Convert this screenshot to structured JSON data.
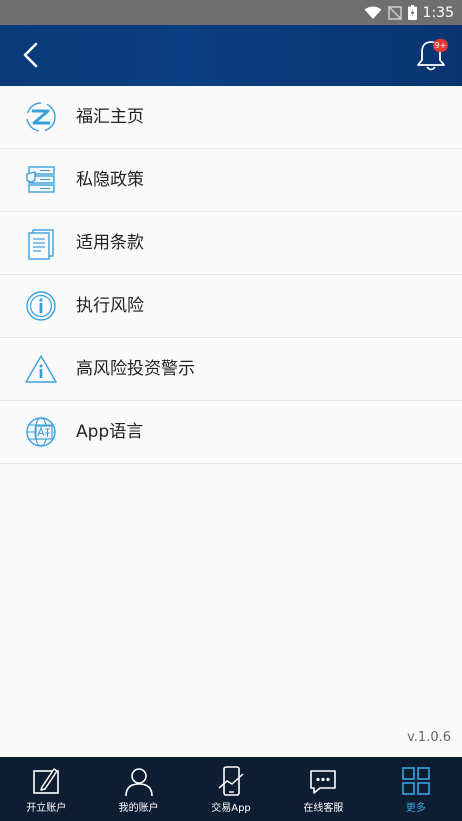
{
  "status_bar": {
    "time": "1:35"
  },
  "header": {
    "notification_badge": "9+"
  },
  "menu": [
    {
      "label": "福汇主页",
      "icon": "fxcm-logo-icon"
    },
    {
      "label": "私隐政策",
      "icon": "privacy-server-icon"
    },
    {
      "label": "适用条款",
      "icon": "document-icon"
    },
    {
      "label": "执行风险",
      "icon": "info-circle-icon"
    },
    {
      "label": "高风险投资警示",
      "icon": "warning-triangle-icon"
    },
    {
      "label": "App语言",
      "icon": "globe-language-icon"
    }
  ],
  "version": "v.1.0.6",
  "tabs": [
    {
      "label": "开立账户",
      "icon": "edit-form-icon",
      "active": false
    },
    {
      "label": "我的账户",
      "icon": "user-icon",
      "active": false
    },
    {
      "label": "交易App",
      "icon": "phone-chart-icon",
      "active": false
    },
    {
      "label": "在线客服",
      "icon": "chat-icon",
      "active": false
    },
    {
      "label": "更多",
      "icon": "grid-icon",
      "active": true
    }
  ],
  "colors": {
    "header": "#0a3a78",
    "accent": "#39a6e6",
    "tabbar": "#0f1d33",
    "badge": "#e53935"
  }
}
